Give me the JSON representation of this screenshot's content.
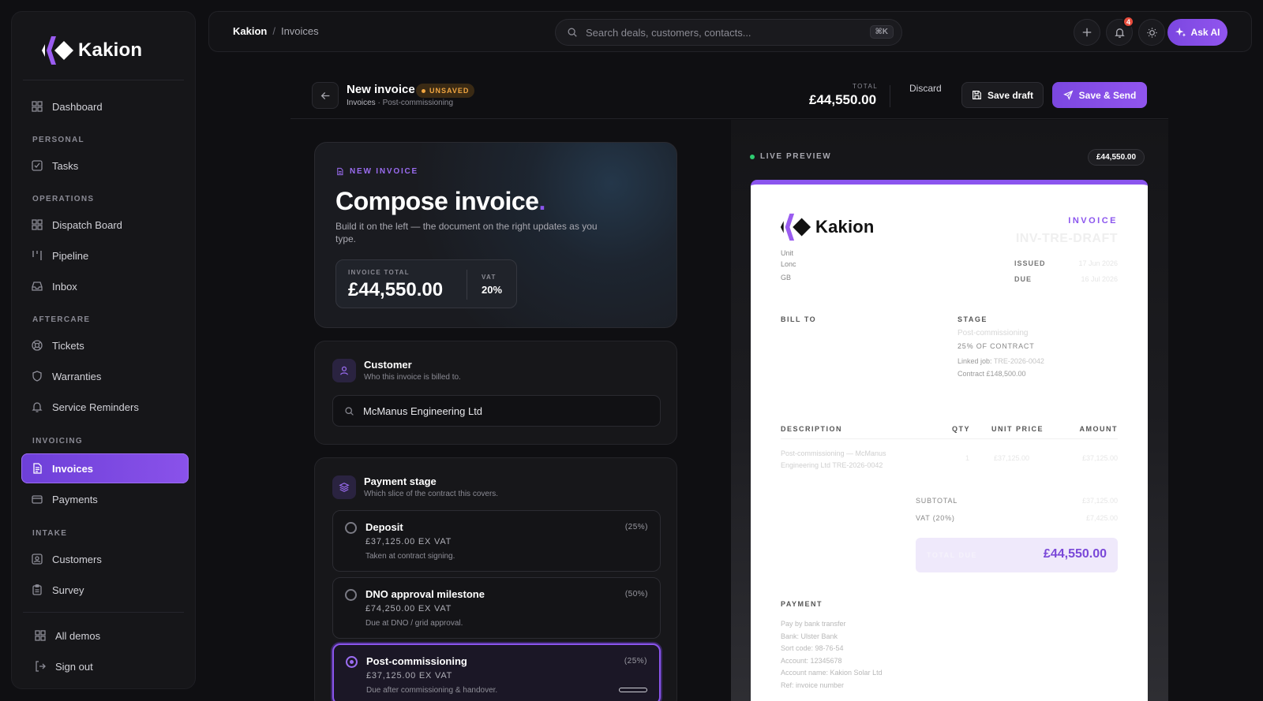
{
  "brand": {
    "name": "Kakion",
    "accent": "#8b55ee"
  },
  "sidebar": {
    "sections": {
      "personal": "PERSONAL",
      "operations": "OPERATIONS",
      "aftercare": "AFTERCARE",
      "invoicing": "INVOICING",
      "intake": "INTAKE"
    },
    "items": {
      "dashboard": "Dashboard",
      "tasks": "Tasks",
      "dispatch": "Dispatch Board",
      "pipeline": "Pipeline",
      "inbox": "Inbox",
      "tickets": "Tickets",
      "warranties": "Warranties",
      "reminders": "Service Reminders",
      "invoices": "Invoices",
      "payments": "Payments",
      "customers": "Customers",
      "survey": "Survey",
      "all_demos": "All demos",
      "sign_out": "Sign out"
    },
    "active": "invoices"
  },
  "topbar": {
    "crumb_root": "Kakion",
    "crumb_sep": "/",
    "crumb_page": "Invoices",
    "search_placeholder": "Search deals, customers, contacts...",
    "search_shortcut": "⌘K",
    "notifications_count": "4",
    "ask_ai": "Ask AI"
  },
  "header": {
    "title": "New invoice",
    "status": "UNSAVED",
    "crumb_parent": "Invoices",
    "crumb_child": "· Post-commissioning",
    "total_label": "TOTAL",
    "total_value": "£44,550.00",
    "discard": "Discard",
    "save_draft": "Save draft",
    "save_send": "Save & Send"
  },
  "hero": {
    "tag": "NEW INVOICE",
    "title": "Compose invoice",
    "title_dot": ".",
    "subtitle": "Build it on the left — the document on the right updates as you type.",
    "total_label": "INVOICE TOTAL",
    "total_value": "£44,550.00",
    "vat_label": "VAT",
    "vat_value": "20%"
  },
  "customer": {
    "title": "Customer",
    "subtitle": "Who this invoice is billed to.",
    "value": "McManus Engineering Ltd"
  },
  "payment_stage": {
    "title": "Payment stage",
    "subtitle": "Which slice of the contract this covers.",
    "options": [
      {
        "name": "Deposit",
        "pct": "(25%)",
        "amount": "£37,125.00 EX VAT",
        "desc": "Taken at contract signing.",
        "selected": false
      },
      {
        "name": "DNO approval milestone",
        "pct": "(50%)",
        "amount": "£74,250.00 EX VAT",
        "desc": "Due at DNO / grid approval.",
        "selected": false
      },
      {
        "name": "Post-commissioning",
        "pct": "(25%)",
        "amount": "£37,125.00 EX VAT",
        "desc": "Due after commissioning & handover.",
        "selected": true
      }
    ]
  },
  "preview": {
    "label": "LIVE PREVIEW",
    "total_pill": "£44,550.00",
    "doc": {
      "invoice_label": "INVOICE",
      "invoice_number": "INV-TRE-DRAFT",
      "addr_1": "Unit",
      "addr_2": "Lonc",
      "addr_3": "GB",
      "issued_label": "ISSUED",
      "issued_value": "17 Jun 2026",
      "due_label": "DUE",
      "due_value": "16 Jul 2026",
      "bill_to_label": "BILL TO",
      "stage_label": "STAGE",
      "stage_value": "Post-commissioning",
      "stage_pct": "25% OF CONTRACT",
      "linked_label": "Linked job:",
      "linked_value": "TRE-2026-0042",
      "contract": "Contract £148,500.00",
      "col_desc": "DESCRIPTION",
      "col_qty": "QTY",
      "col_unit": "UNIT PRICE",
      "col_amount": "AMOUNT",
      "line_desc_1": "Post-commissioning — McManus",
      "line_desc_2": "Engineering Ltd TRE-2026-0042",
      "line_qty": "1",
      "line_unit": "£37,125.00",
      "line_amount": "£37,125.00",
      "subtotal_label": "SUBTOTAL",
      "subtotal_value": "£37,125.00",
      "vat_label": "VAT (20%)",
      "vat_value": "£7,425.00",
      "total_due_label": "TOTAL DUE",
      "total_due_value": "£44,550.00",
      "payment_label": "PAYMENT",
      "payment_lines": [
        "Pay by bank transfer",
        "Bank: Ulster Bank",
        "Sort code: 98-76-54",
        "Account: 12345678",
        "Account name: Kakion Solar Ltd",
        "Ref: invoice number"
      ]
    }
  }
}
